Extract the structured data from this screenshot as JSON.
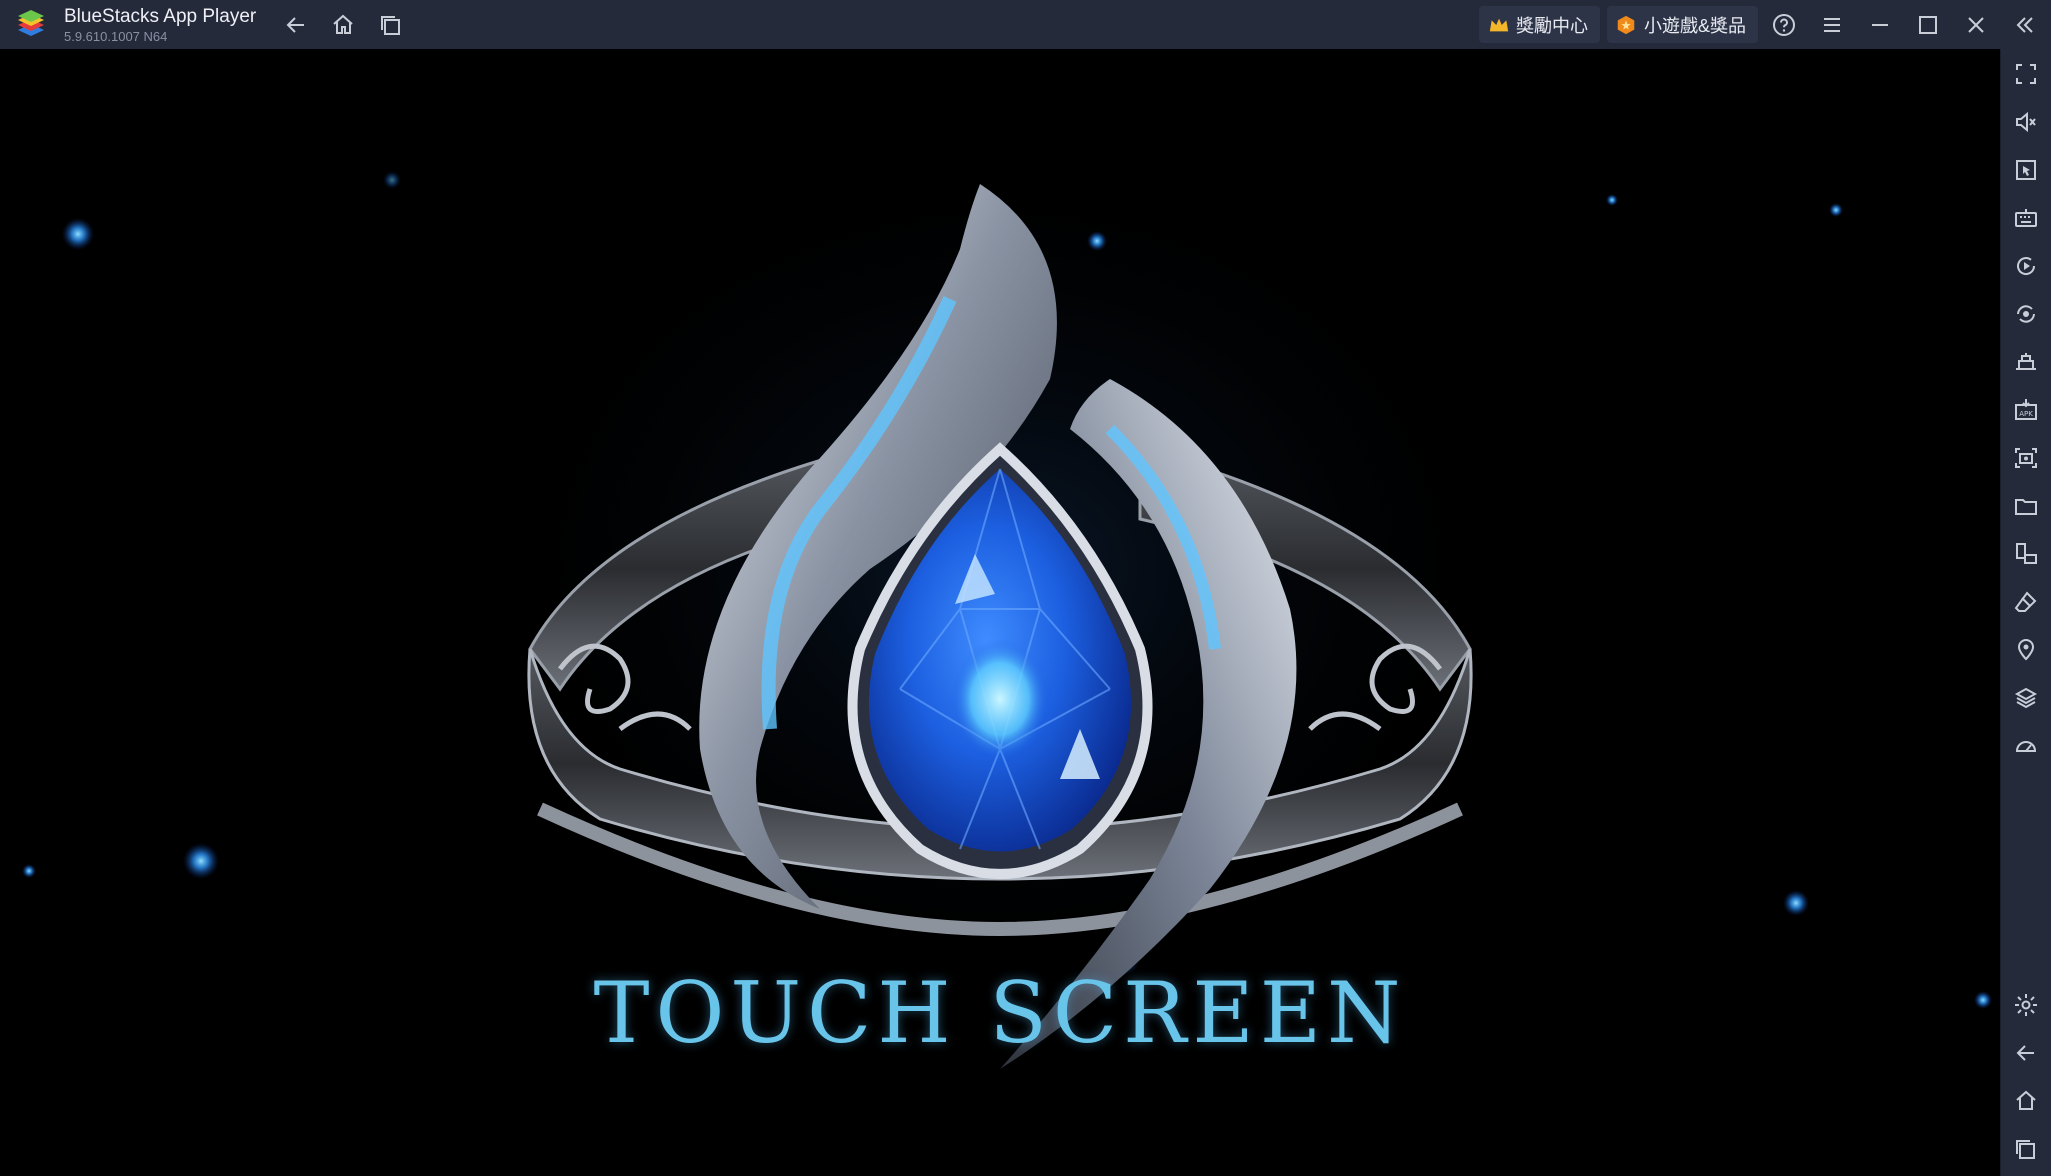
{
  "titlebar": {
    "app_name": "BlueStacks App Player",
    "version": "5.9.610.1007  N64",
    "rewards_label": "獎勵中心",
    "minigames_label": "小遊戲&獎品"
  },
  "game": {
    "touch_label": "TOUCH SCREEN"
  },
  "colors": {
    "titlebar_bg": "#252a3b",
    "sidebar_bg": "#252a3b",
    "touch_text": "#69c4ea",
    "gem_blue": "#1c5fe0",
    "crown_gold": "#f3b62b",
    "minigame_orange": "#f28a1b"
  },
  "sidebar_icons": [
    "fullscreen-icon",
    "volume-icon",
    "pointer-icon",
    "keyboard-icon",
    "macro-play-icon",
    "rotate-icon",
    "multi-instance-icon",
    "apk-install-icon",
    "screenshot-icon",
    "folder-icon",
    "resize-icon",
    "eraser-icon",
    "location-icon",
    "layers-icon",
    "performance-icon",
    "settings-icon",
    "back-icon",
    "home-icon",
    "recent-apps-icon"
  ]
}
